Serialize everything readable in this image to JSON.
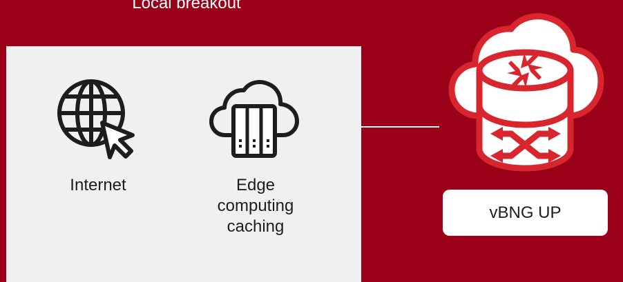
{
  "diagram": {
    "title": "Local breakout",
    "nodes": {
      "internet": {
        "label": "Internet",
        "icon": "globe-cursor-icon"
      },
      "edge": {
        "label_lines": [
          "Edge",
          "computing",
          "caching"
        ],
        "icon": "cloud-server-icon"
      },
      "vbng": {
        "label": "vBNG UP",
        "icon": "cloud-router-icon"
      }
    },
    "connector": {
      "from": "local-breakout-panel",
      "to": "vbng"
    }
  },
  "colors": {
    "background": "#9a0018",
    "panel": "#f0f0f1",
    "icon_dark": "#1d1d1f",
    "accent_red": "#d9252e",
    "white": "#ffffff"
  }
}
